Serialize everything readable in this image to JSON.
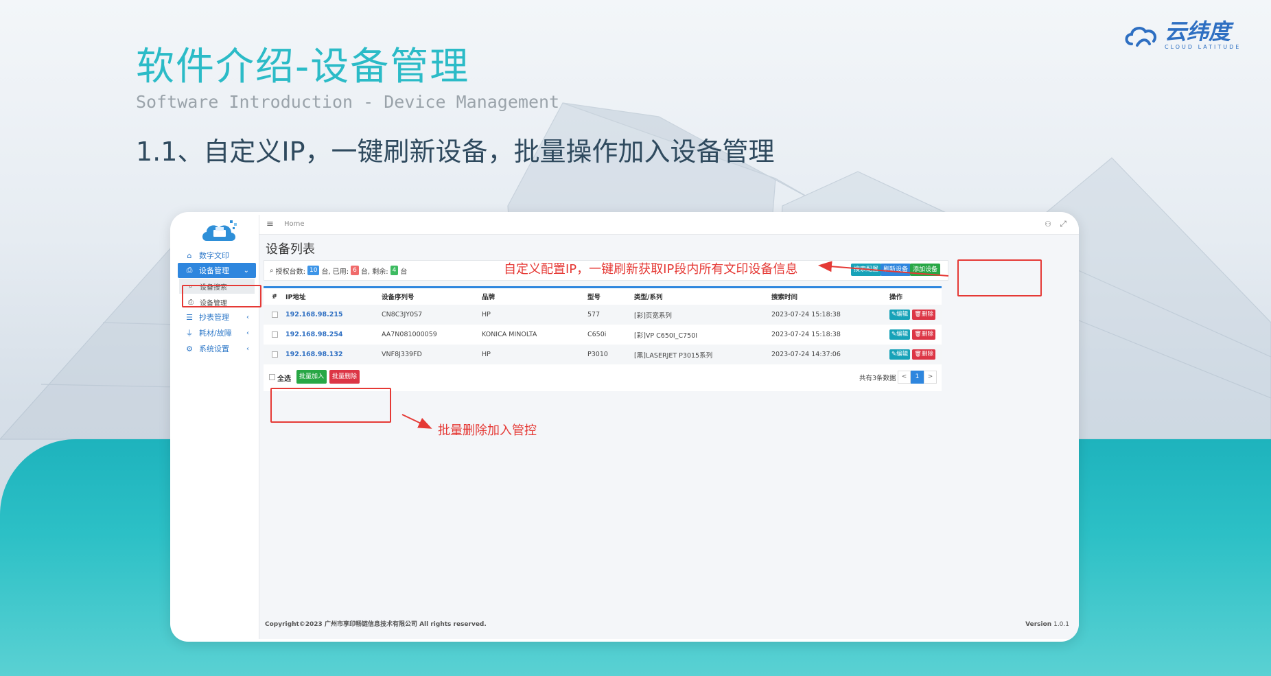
{
  "slide": {
    "title": "软件介绍-设备管理",
    "subtitle": "Software Introduction - Device Management",
    "heading": "1.1、自定义IP，一键刷新设备，批量操作加入设备管理",
    "logo_text": "云纬度",
    "logo_sub": "CLOUD LATITUDE"
  },
  "colors": {
    "accent": "#2bbbc7",
    "brand": "#2e6fc2",
    "primary": "#2e86de",
    "success": "#28a745",
    "danger": "#dc3545",
    "info": "#17a2b8",
    "annotation": "#e53935"
  },
  "topbar": {
    "menu_icon": "≡",
    "breadcrumb": "Home",
    "user_icon": "user-icon",
    "fullscreen_icon": "fullscreen-icon"
  },
  "sidebar": {
    "items": [
      {
        "label": "数字文印",
        "icon": "home-icon"
      },
      {
        "label": "设备管理",
        "icon": "printer-icon"
      },
      {
        "label": "设备搜索",
        "icon": "search-icon"
      },
      {
        "label": "设备管理",
        "icon": "printer-icon"
      },
      {
        "label": "抄表管理",
        "icon": "list-icon"
      },
      {
        "label": "耗材/故障",
        "icon": "plug-icon"
      },
      {
        "label": "系统设置",
        "icon": "gears-icon"
      }
    ]
  },
  "main": {
    "title": "设备列表",
    "info": {
      "prefix": "授权台数:",
      "total": "10",
      "unit1": "台, 已用:",
      "used": "6",
      "unit2": "台, 剩余:",
      "remaining": "4",
      "unit3": "台"
    },
    "buttons": {
      "search_config": "搜索配置",
      "refresh": "刷新设备",
      "add": "添加设备"
    },
    "table": {
      "headers": [
        "#",
        "IP地址",
        "设备序列号",
        "品牌",
        "型号",
        "类型/系列",
        "搜索时间",
        "操作"
      ],
      "rows": [
        {
          "ip": "192.168.98.215",
          "serial": "CN8C3JY0S7",
          "brand": "HP",
          "model": "577",
          "type": "[彩]页宽系列",
          "time": "2023-07-24 15:18:38"
        },
        {
          "ip": "192.168.98.254",
          "serial": "AA7N081000059",
          "brand": "KONICA MINOLTA",
          "model": "C650i",
          "type": "[彩]VP C650I_C750I",
          "time": "2023-07-24 15:18:38"
        },
        {
          "ip": "192.168.98.132",
          "serial": "VNF8J339FD",
          "brand": "HP",
          "model": "P3010",
          "type": "[黑]LASERJET P3015系列",
          "time": "2023-07-24 14:37:06"
        }
      ],
      "edit": "编辑",
      "delete": "删除"
    },
    "footer": {
      "select_all": "全选",
      "batch_add": "批量加入",
      "batch_delete": "批量删除",
      "total_text": "共有3条数据",
      "page_prev": "<",
      "page_current": "1",
      "page_next": ">"
    },
    "copyright": "Copyright©2023 广州市享印畅链信息技术有限公司 All rights reserved.",
    "version_label": "Version",
    "version": "1.0.1"
  },
  "annotations": {
    "top": "自定义配置IP，一键刷新获取IP段内所有文印设备信息",
    "bottom": "批量删除加入管控"
  }
}
